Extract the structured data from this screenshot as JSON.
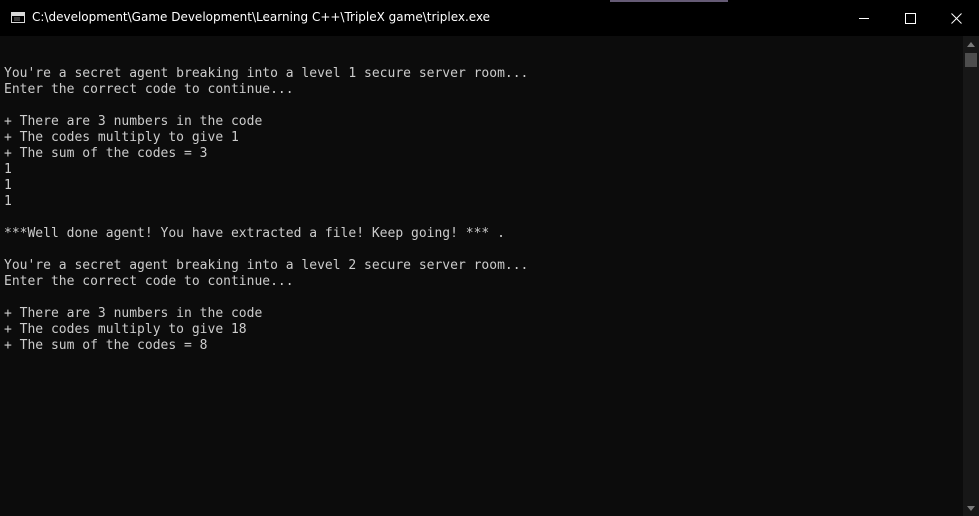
{
  "window": {
    "title": "C:\\development\\Game Development\\Learning C++\\TripleX game\\triplex.exe",
    "icon": "console-app-icon",
    "controls": {
      "minimize": "minimize-icon",
      "maximize": "maximize-icon",
      "close": "close-icon"
    }
  },
  "console": {
    "lines": [
      "",
      "You're a secret agent breaking into a level 1 secure server room...",
      "Enter the correct code to continue...",
      "",
      "+ There are 3 numbers in the code",
      "+ The codes multiply to give 1",
      "+ The sum of the codes = 3",
      "1",
      "1",
      "1",
      "",
      "***Well done agent! You have extracted a file! Keep going! *** .",
      "",
      "You're a secret agent breaking into a level 2 secure server room...",
      "Enter the correct code to continue...",
      "",
      "+ There are 3 numbers in the code",
      "+ The codes multiply to give 18",
      "+ The sum of the codes = 8"
    ]
  },
  "colors": {
    "background": "#0c0c0c",
    "titlebar": "#000000",
    "text": "#cccccc",
    "scrollbar_track": "#171717",
    "scrollbar_thumb": "#4d4d4d"
  }
}
